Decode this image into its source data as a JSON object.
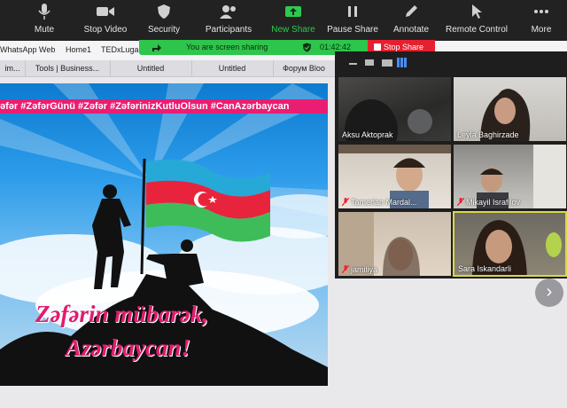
{
  "toolbar": {
    "mute": "Mute",
    "stop_video": "Stop Video",
    "security": "Security",
    "participants": "Participants",
    "new_share": "New Share",
    "pause_share": "Pause Share",
    "annotate": "Annotate",
    "remote_control": "Remote Control",
    "more": "More"
  },
  "share_status": {
    "text": "You are screen sharing",
    "timer": "01:42:42",
    "stop_label": "Stop Share"
  },
  "bookmarks": [
    "WhatsApp Web",
    "Home1",
    "TEDxLugano"
  ],
  "tabs": [
    "im...",
    "Tools | Business...",
    "Untitled",
    "Untitled",
    "Форум Bloo"
  ],
  "slide": {
    "hashtags": "əfər #ZəfərGünü #Zəfər #ZəfərinizKutluOlsun #CanAzərbaycan",
    "slogan_line1": "Zəfərin mübarək,",
    "slogan_line2": "Azərbaycan!"
  },
  "participants": [
    {
      "name": "Aksu Aktoprak",
      "muted": false
    },
    {
      "name": "Leyla Baghirzade",
      "muted": false
    },
    {
      "name": "Tamerlan Mardal...",
      "muted": true
    },
    {
      "name": "Mikayil Israfilov",
      "muted": true
    },
    {
      "name": "jamiliya",
      "muted": true
    },
    {
      "name": "Sara Iskandarli",
      "muted": false
    }
  ],
  "colors": {
    "toolbar_bg": "#222222",
    "new_share_green": "#2dca4e",
    "sharing_banner": "#2dc54b",
    "stop_share_red": "#e6202f",
    "hashtag_pink": "#ea1d73",
    "slogan_pink": "#e01c6d"
  }
}
